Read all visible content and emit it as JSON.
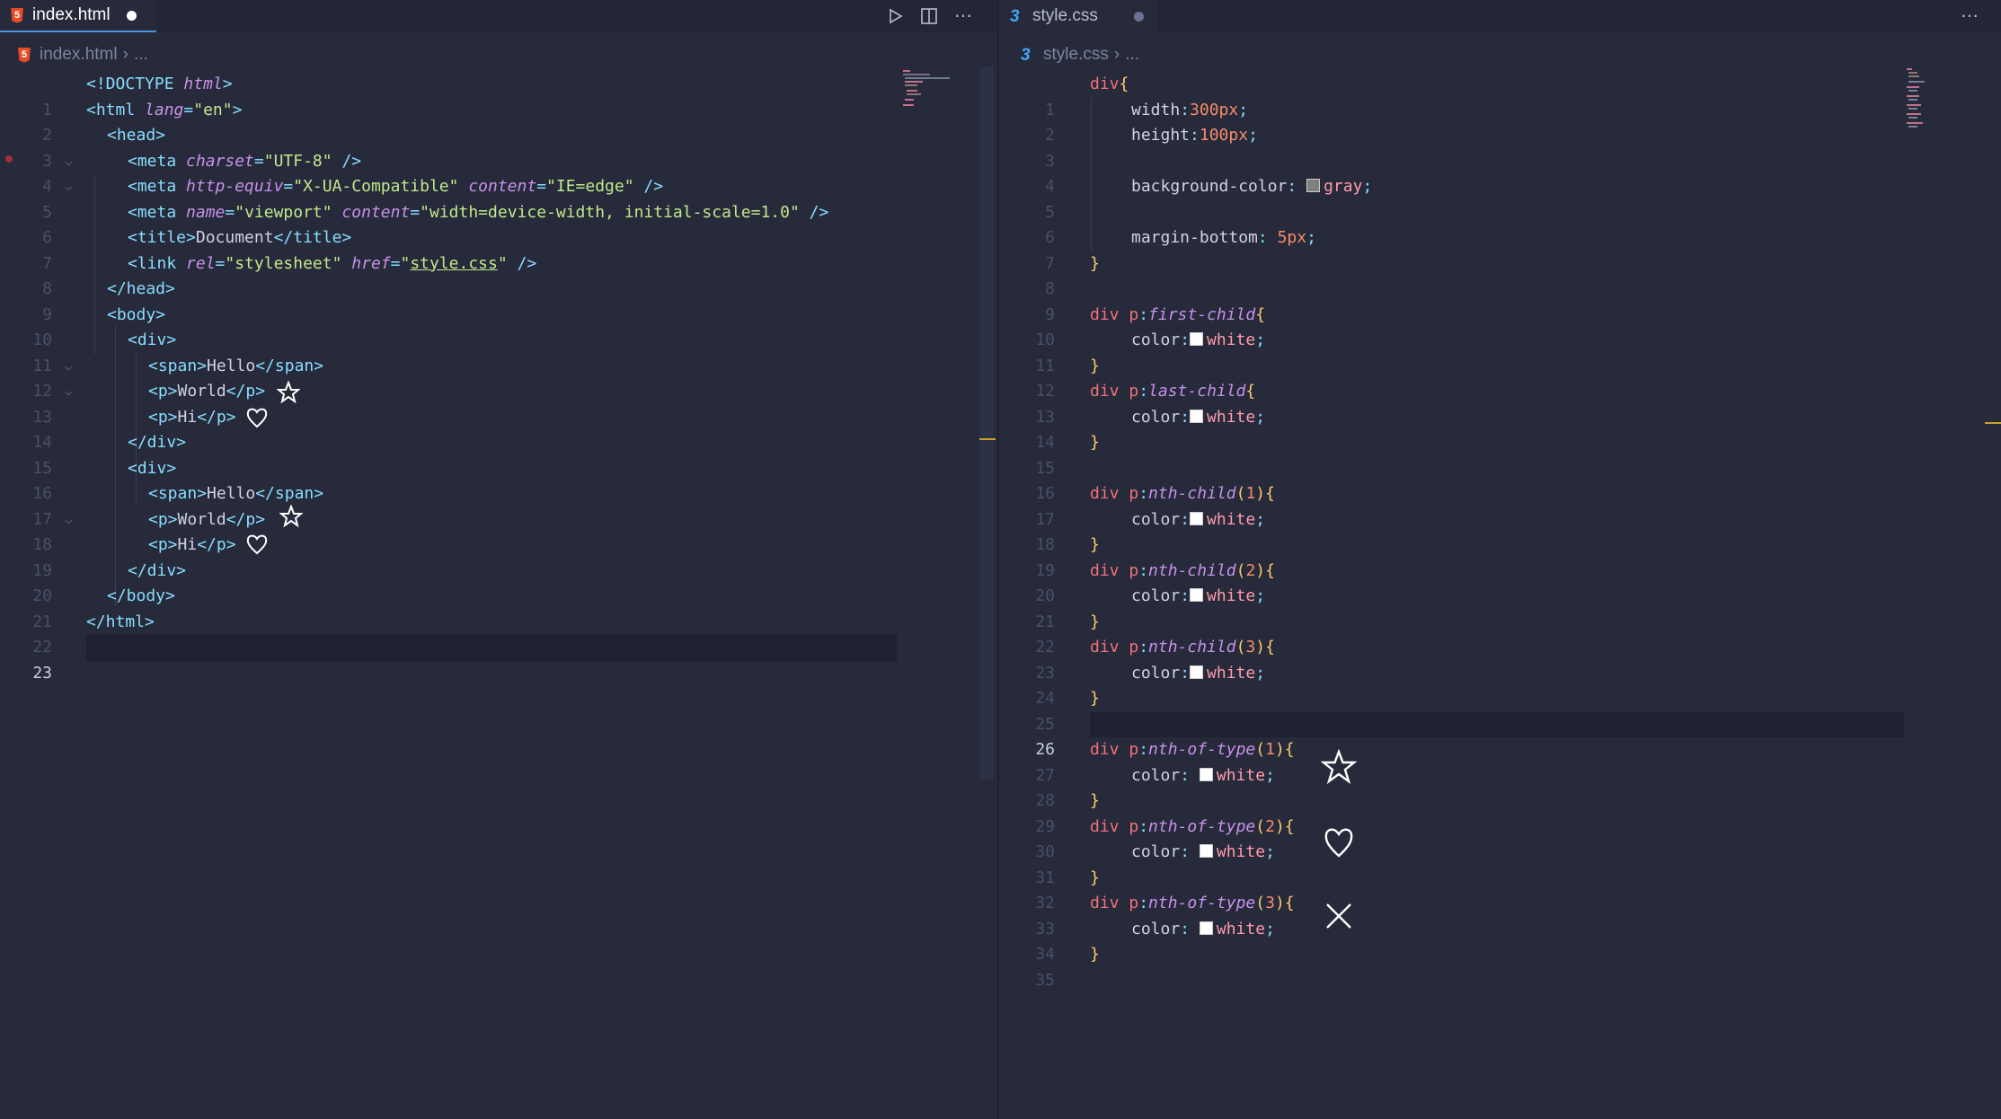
{
  "left_editor": {
    "tab_title": "index.html",
    "breadcrumb_file": "index.html",
    "breadcrumb_rest": "...",
    "lines": [
      {
        "n": "1"
      },
      {
        "n": "2"
      },
      {
        "n": "3"
      },
      {
        "n": "4"
      },
      {
        "n": "5"
      },
      {
        "n": "6"
      },
      {
        "n": "7"
      },
      {
        "n": "8"
      },
      {
        "n": "9"
      },
      {
        "n": "10"
      },
      {
        "n": "11"
      },
      {
        "n": "12"
      },
      {
        "n": "13"
      },
      {
        "n": "14"
      },
      {
        "n": "15"
      },
      {
        "n": "16"
      },
      {
        "n": "17"
      },
      {
        "n": "18"
      },
      {
        "n": "19"
      },
      {
        "n": "20"
      },
      {
        "n": "21"
      },
      {
        "n": "22"
      },
      {
        "n": "23"
      }
    ],
    "text": {
      "doctype": "<!DOCTYPE",
      "html_kw": "html",
      "close_gt": ">",
      "html_open": "<html",
      "lang_attr": "lang",
      "eq": "=",
      "lang_val": "\"en\"",
      "head": "<head>",
      "meta": "<meta",
      "charset": "charset",
      "charset_val": "\"UTF-8\"",
      "selfclose": "/>",
      "http_equiv": "http-equiv",
      "http_equiv_val": "\"X-UA-Compatible\"",
      "content": "content",
      "content_val1": "\"IE=edge\"",
      "name": "name",
      "name_val": "\"viewport\"",
      "content_val2": "\"width=device-width, initial-scale=1.0\"",
      "title_open": "<title>",
      "title_text": "Document",
      "title_close": "</title>",
      "link": "<link",
      "rel": "rel",
      "rel_val": "\"stylesheet\"",
      "href": "href",
      "href_q": "\"",
      "href_val": "style.css",
      "head_close": "</head>",
      "body_open": "<body>",
      "div_open": "<div>",
      "span_open": "<span>",
      "hello": "Hello",
      "span_close": "</span>",
      "p_open": "<p>",
      "world": "World",
      "p_close": "</p>",
      "hi": "Hi",
      "div_close": "</div>",
      "body_close": "</body>",
      "html_close": "</html>"
    }
  },
  "right_editor": {
    "tab_title": "style.css",
    "breadcrumb_file": "style.css",
    "breadcrumb_rest": "...",
    "lines": [
      {
        "n": "1"
      },
      {
        "n": "2"
      },
      {
        "n": "3"
      },
      {
        "n": "4"
      },
      {
        "n": "5"
      },
      {
        "n": "6"
      },
      {
        "n": "7"
      },
      {
        "n": "8"
      },
      {
        "n": "9"
      },
      {
        "n": "10"
      },
      {
        "n": "11"
      },
      {
        "n": "12"
      },
      {
        "n": "13"
      },
      {
        "n": "14"
      },
      {
        "n": "15"
      },
      {
        "n": "16"
      },
      {
        "n": "17"
      },
      {
        "n": "18"
      },
      {
        "n": "19"
      },
      {
        "n": "20"
      },
      {
        "n": "21"
      },
      {
        "n": "22"
      },
      {
        "n": "23"
      },
      {
        "n": "24"
      },
      {
        "n": "25"
      },
      {
        "n": "26"
      },
      {
        "n": "27"
      },
      {
        "n": "28"
      },
      {
        "n": "29"
      },
      {
        "n": "30"
      },
      {
        "n": "31"
      },
      {
        "n": "32"
      },
      {
        "n": "33"
      },
      {
        "n": "34"
      },
      {
        "n": "35"
      }
    ],
    "text": {
      "div": "div",
      "ob": "{",
      "cb": "}",
      "p": "p",
      "colon": ":",
      "semi": ";",
      "width": "width",
      "width_val": "300px",
      "height": "height",
      "height_val": "100px",
      "bg": "background-color",
      "gray": "gray",
      "mb": "margin-bottom",
      "mb_val": "5px",
      "first": "first-child",
      "last": "last-child",
      "nth": "nth-child",
      "nthtype": "nth-of-type",
      "op": "(",
      "cp": ")",
      "one": "1",
      "two": "2",
      "three": "3",
      "color": "color",
      "white": "white"
    }
  },
  "annotations": {
    "star": "star-icon",
    "heart": "heart-icon",
    "cross": "x-mark-icon"
  },
  "colors": {
    "background": "#262a3a",
    "tab_active_border": "#4d95d6",
    "modified_dot": "#ffffff",
    "unsaved_dot": "#6b7190"
  }
}
